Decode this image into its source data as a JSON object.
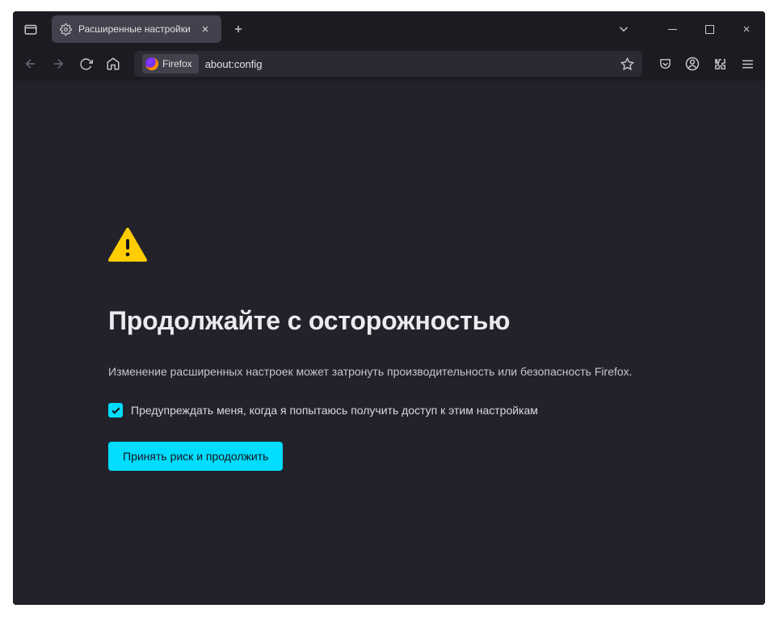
{
  "titlebar": {
    "tab_title": "Расширенные настройки"
  },
  "navbar": {
    "pill_label": "Firefox",
    "url": "about:config"
  },
  "content": {
    "heading": "Продолжайте с осторожностью",
    "description": "Изменение расширенных настроек может затронуть производительность или безопасность Firefox.",
    "checkbox_label": "Предупреждать меня, когда я попытаюсь получить доступ к этим настройкам",
    "accept_label": "Принять риск и продолжить"
  }
}
